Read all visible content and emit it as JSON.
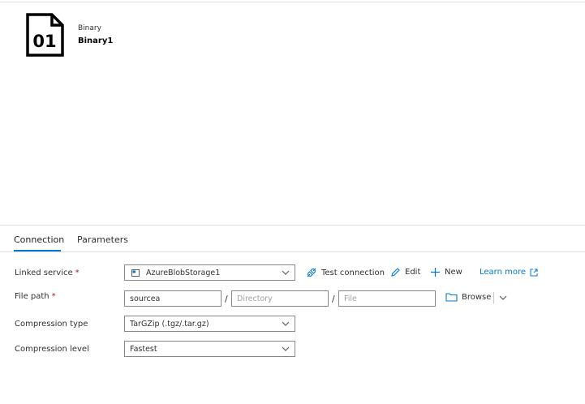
{
  "dataset": {
    "icon_label": "01",
    "type": "Binary",
    "name": "Binary1"
  },
  "tabs": [
    {
      "label": "Connection",
      "active": true
    },
    {
      "label": "Parameters",
      "active": false
    }
  ],
  "linked_service": {
    "label": "Linked service",
    "required_mark": "*",
    "value": "AzureBlobStorage1",
    "test_connection": "Test connection",
    "edit": "Edit",
    "new": "New",
    "learn_more": "Learn more"
  },
  "file_path": {
    "label": "File path",
    "required_mark": "*",
    "container": "sourcea",
    "directory_placeholder": "Directory",
    "file_placeholder": "File",
    "separator": "/",
    "browse": "Browse"
  },
  "compression_type": {
    "label": "Compression type",
    "value": "TarGZip (.tgz/.tar.gz)"
  },
  "compression_level": {
    "label": "Compression level",
    "value": "Fastest"
  },
  "colors": {
    "accent": "#0078d4",
    "required": "#a4262c"
  }
}
